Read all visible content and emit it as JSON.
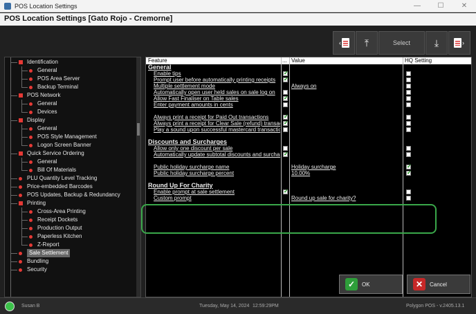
{
  "window": {
    "title": "POS Location Settings",
    "header": "POS Location Settings [Gato Rojo - Cremorne]"
  },
  "toolbar": {
    "select_label": "Select"
  },
  "tree": [
    {
      "label": "Identification",
      "level": 1,
      "type": "sq"
    },
    {
      "label": "General",
      "level": 2,
      "type": "dot"
    },
    {
      "label": "POS Area Server",
      "level": 2,
      "type": "dot"
    },
    {
      "label": "Backup Terminal",
      "level": 2,
      "type": "dot"
    },
    {
      "label": "POS Network",
      "level": 1,
      "type": "sq"
    },
    {
      "label": "General",
      "level": 2,
      "type": "dot"
    },
    {
      "label": "Devices",
      "level": 2,
      "type": "dot"
    },
    {
      "label": "Display",
      "level": 1,
      "type": "sq"
    },
    {
      "label": "General",
      "level": 2,
      "type": "dot"
    },
    {
      "label": "POS Style Management",
      "level": 2,
      "type": "dot"
    },
    {
      "label": "Logon Screen Banner",
      "level": 2,
      "type": "dot"
    },
    {
      "label": "Quick Service Ordering",
      "level": 1,
      "type": "sq"
    },
    {
      "label": "General",
      "level": 2,
      "type": "dot"
    },
    {
      "label": "Bill Of Materials",
      "level": 2,
      "type": "dot"
    },
    {
      "label": "PLU Quantity Level Tracking",
      "level": 1,
      "type": "dot"
    },
    {
      "label": "Price-embedded Barcodes",
      "level": 1,
      "type": "dot"
    },
    {
      "label": "POS Updates, Backup & Redundancy",
      "level": 1,
      "type": "dot"
    },
    {
      "label": "Printing",
      "level": 1,
      "type": "sq"
    },
    {
      "label": "Cross-Area Printing",
      "level": 2,
      "type": "dot"
    },
    {
      "label": "Receipt Dockets",
      "level": 2,
      "type": "dot"
    },
    {
      "label": "Production Output",
      "level": 2,
      "type": "dot"
    },
    {
      "label": "Paperless Kitchen",
      "level": 2,
      "type": "dot"
    },
    {
      "label": "Z-Report",
      "level": 2,
      "type": "dot"
    },
    {
      "label": "Sale Settlement",
      "level": 1,
      "type": "dot",
      "selected": true
    },
    {
      "label": "Bundling",
      "level": 1,
      "type": "dot"
    },
    {
      "label": "Security",
      "level": 1,
      "type": "dot"
    }
  ],
  "grid": {
    "columns": {
      "feature": "Feature",
      "dots": "...",
      "value": "Value",
      "hq": "HQ Setting"
    },
    "rows": [
      {
        "section": true,
        "feature": "General"
      },
      {
        "feature": "Enable tips",
        "checked": true,
        "value": "",
        "hq": false
      },
      {
        "feature": "Prompt user before automatically printing receipts",
        "checked": true,
        "value": "",
        "hq": false
      },
      {
        "feature": "Multiple settlement mode",
        "checked": null,
        "value": "Always on",
        "hq": false
      },
      {
        "feature": "Automatically open user held sales on sale log on",
        "checked": false,
        "value": "",
        "hq": false
      },
      {
        "feature": "Allow Fast Finaliser on Table sales",
        "checked": true,
        "value": "",
        "hq": false
      },
      {
        "feature": "Enter payment amounts in cents",
        "checked": false,
        "value": "",
        "hq": false
      },
      {
        "feature": "",
        "checked": null,
        "value": "",
        "hq": null
      },
      {
        "feature": "Always print a receipt for Paid Out transactions",
        "checked": true,
        "value": "",
        "hq": false
      },
      {
        "feature": "Always print a receipt for Clear Sale (refund) transactions",
        "checked": true,
        "value": "",
        "hq": false
      },
      {
        "feature": "Play a sound upon successful mastercard transactions",
        "checked": false,
        "value": "",
        "hq": false
      },
      {
        "feature": "",
        "checked": null,
        "value": "",
        "hq": null
      },
      {
        "section": true,
        "feature": "Discounts and Surcharges"
      },
      {
        "feature": "Allow only one discount per sale",
        "checked": false,
        "value": "",
        "hq": false
      },
      {
        "feature": "Automatically update subtotal discounts and surcharges",
        "checked": true,
        "value": "",
        "hq": false
      },
      {
        "feature": "",
        "checked": null,
        "value": "",
        "hq": null
      },
      {
        "feature": "Public holiday surcharge name",
        "checked": null,
        "value": "Holiday surcharge",
        "hq": true
      },
      {
        "feature": "Public holiday surcharge percent",
        "checked": null,
        "value": "10.00%",
        "hq": true
      },
      {
        "feature": "",
        "checked": null,
        "value": "",
        "hq": null
      },
      {
        "section": true,
        "feature": "Round Up For Charity"
      },
      {
        "feature": "Enable prompt at sale settlement",
        "checked": true,
        "value": "",
        "hq": false
      },
      {
        "feature": "Custom prompt",
        "checked": null,
        "value": "Round up sale for charity?",
        "hq": false
      }
    ]
  },
  "buttons": {
    "ok": "OK",
    "cancel": "Cancel"
  },
  "status": {
    "user": "Susan B",
    "date": "Tuesday, May 14, 2024",
    "time": "12:59:29PM",
    "version": "Polygon POS - v.2405.13.1"
  },
  "colors": {
    "accent_red": "#e53935",
    "ok_green": "#2e9e3a",
    "cancel_red": "#c62828",
    "highlight": "#3aa84a"
  }
}
